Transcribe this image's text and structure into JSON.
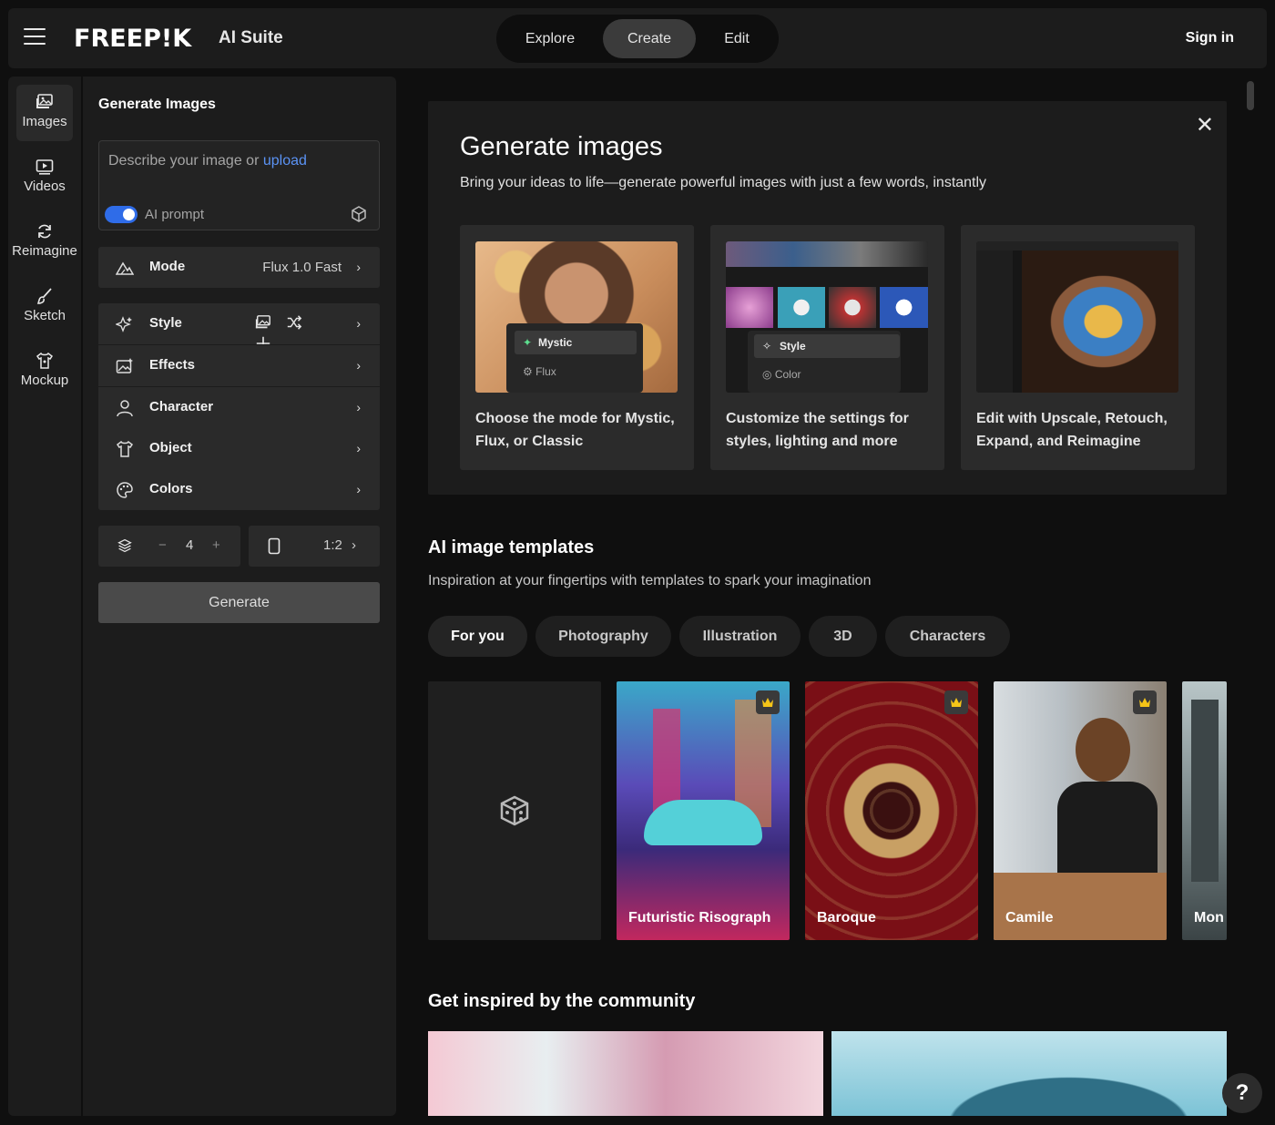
{
  "header": {
    "logo": "FREEP!K",
    "suite": "AI Suite",
    "nav": [
      "Explore",
      "Create",
      "Edit"
    ],
    "active_nav": "Create",
    "sign_in": "Sign in"
  },
  "rail": [
    {
      "label": "Images",
      "icon": "images-icon"
    },
    {
      "label": "Videos",
      "icon": "video-icon"
    },
    {
      "label": "Reimagine",
      "icon": "reimagine-icon"
    },
    {
      "label": "Sketch",
      "icon": "brush-icon"
    },
    {
      "label": "Mockup",
      "icon": "mockup-icon"
    }
  ],
  "panel": {
    "title": "Generate Images",
    "prompt_placeholder": "Describe your image or ",
    "upload_link": "upload",
    "ai_prompt_label": "AI prompt",
    "mode": {
      "label": "Mode",
      "value": "Flux 1.0 Fast"
    },
    "style": "Style",
    "effects": "Effects",
    "character": "Character",
    "object": "Object",
    "colors": "Colors",
    "count": "4",
    "minus": "−",
    "plus": "+",
    "ratio": "1:2",
    "generate": "Generate"
  },
  "hero": {
    "title": "Generate images",
    "subtitle": "Bring your ideas to life—generate powerful images with just a few words, instantly",
    "cards": [
      {
        "text": "Choose the mode for Mystic, Flux, or Classic",
        "chip1": "Mystic",
        "chip2": "Flux"
      },
      {
        "text": "Customize the settings for styles, lighting and more",
        "chip1": "Style",
        "chip2": "Color"
      },
      {
        "text": "Edit with Upscale, Retouch, Expand, and Reimagine"
      }
    ]
  },
  "templates": {
    "title": "AI image templates",
    "subtitle": "Inspiration at your fingertips with templates to spark your imagination",
    "chips": [
      "For you",
      "Photography",
      "Illustration",
      "3D",
      "Characters"
    ],
    "items": [
      "Futuristic Risograph",
      "Baroque",
      "Camile",
      "Mon"
    ]
  },
  "community": {
    "title": "Get inspired by the community"
  },
  "help": "?",
  "colors": {
    "accent": "#2f6ce8",
    "link": "#5b93f5",
    "bg": "#0f0f0f",
    "panel": "#1c1c1c"
  }
}
